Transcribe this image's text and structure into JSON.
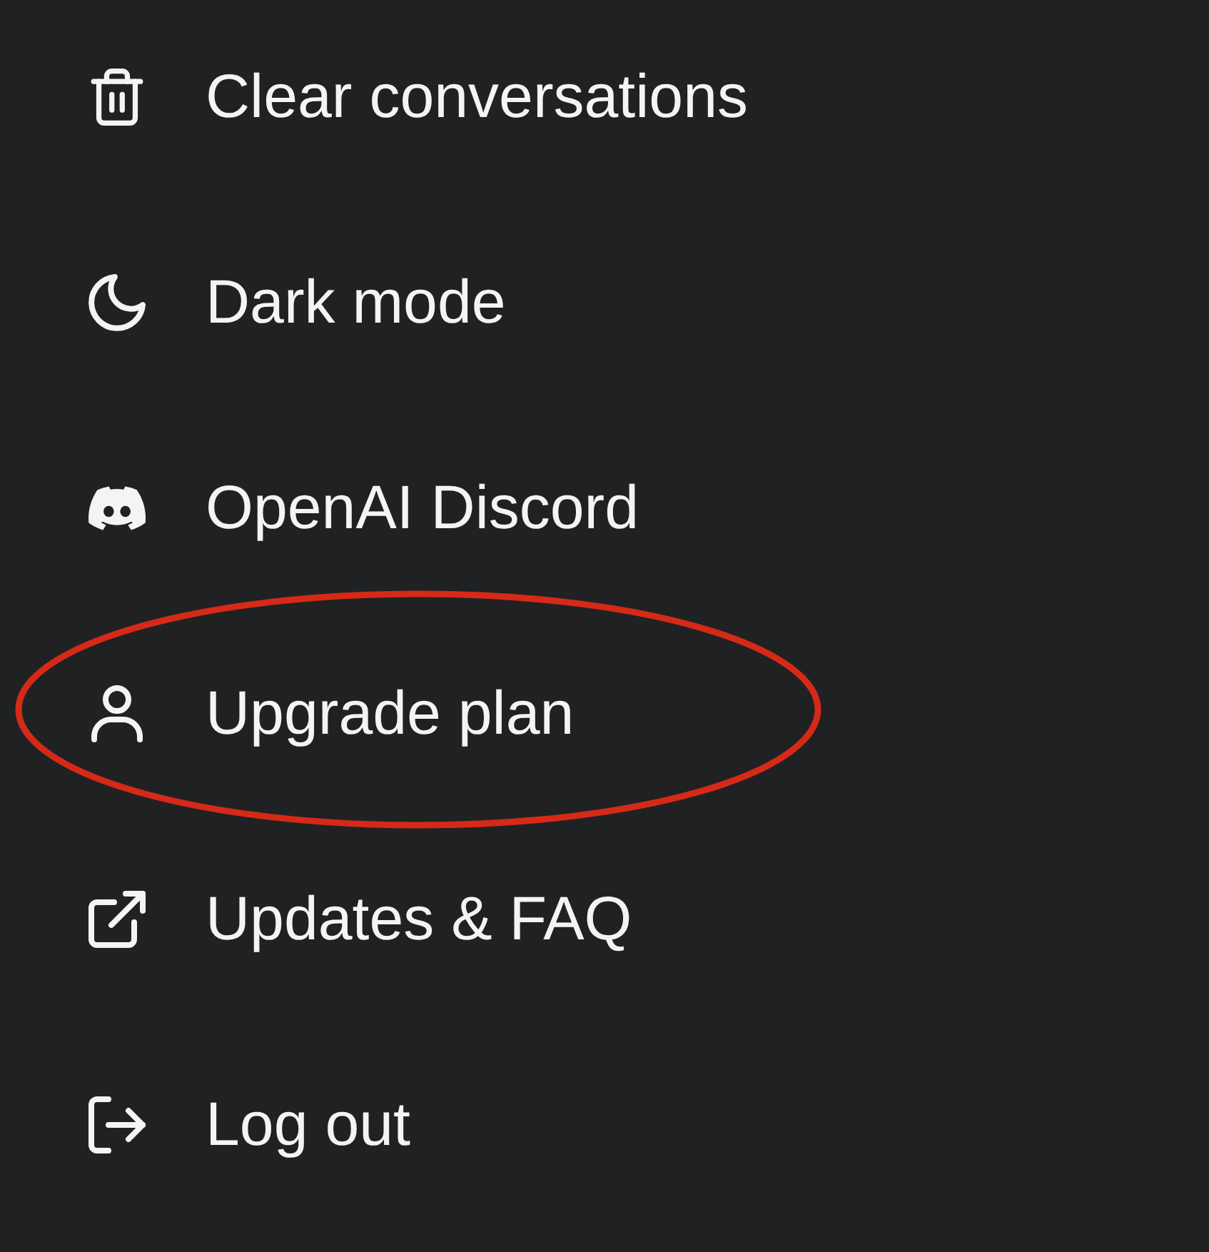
{
  "menu": {
    "items": [
      {
        "label": "Clear conversations",
        "circled": false
      },
      {
        "label": "Dark mode",
        "circled": false
      },
      {
        "label": "OpenAI Discord",
        "circled": false
      },
      {
        "label": "Upgrade plan",
        "circled": true
      },
      {
        "label": "Updates & FAQ",
        "circled": false
      },
      {
        "label": "Log out",
        "circled": false
      }
    ]
  }
}
